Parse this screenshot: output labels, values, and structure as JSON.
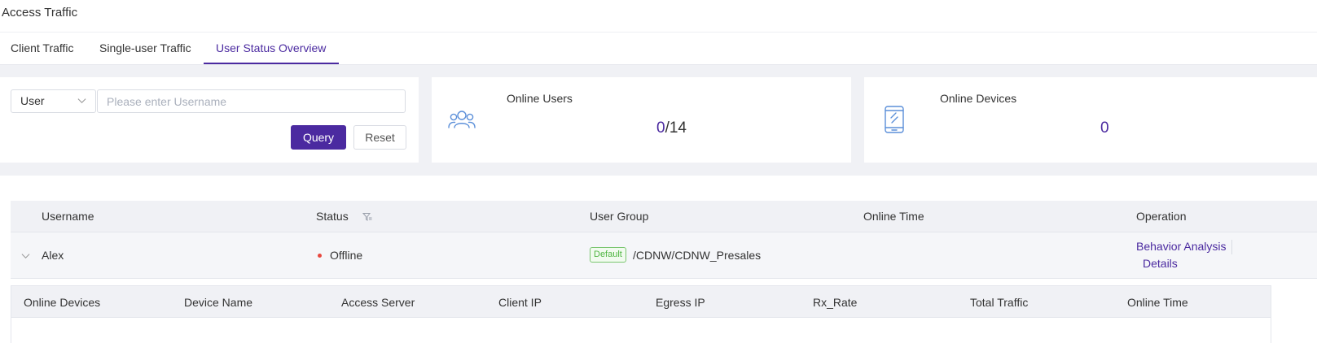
{
  "header": {
    "title": "Access Traffic",
    "tabs": [
      {
        "label": "Client Traffic"
      },
      {
        "label": "Single-user Traffic"
      },
      {
        "label": "User Status Overview",
        "active": true
      }
    ]
  },
  "query": {
    "select_value": "User",
    "input_placeholder": "Please enter Username",
    "query_label": "Query",
    "reset_label": "Reset"
  },
  "stats": {
    "online_users": {
      "label": "Online Users",
      "online": "0",
      "total": "/14",
      "icon": "users-icon"
    },
    "online_devices": {
      "label": "Online Devices",
      "value": "0",
      "icon": "mobile-device-icon"
    }
  },
  "table": {
    "columns": [
      "Username",
      "Status",
      "User Group",
      "Online Time",
      "Operation"
    ],
    "rows": [
      {
        "username": "Alex",
        "status": "Offline",
        "group_tag": "Default",
        "group_path": "/CDNW/CDNW_Presales",
        "online_time": "",
        "operations": [
          "Behavior Analysis",
          "Details"
        ]
      }
    ]
  },
  "subtable": {
    "columns": [
      "Online Devices",
      "Device Name",
      "Access Server",
      "Client IP",
      "Egress IP",
      "Rx_Rate",
      "Total Traffic",
      "Online Time"
    ]
  },
  "colors": {
    "accent": "#4b2aa0",
    "offline": "#e8483f",
    "tag_green": "#4fb542",
    "icon_blue": "#5b8fd9"
  }
}
